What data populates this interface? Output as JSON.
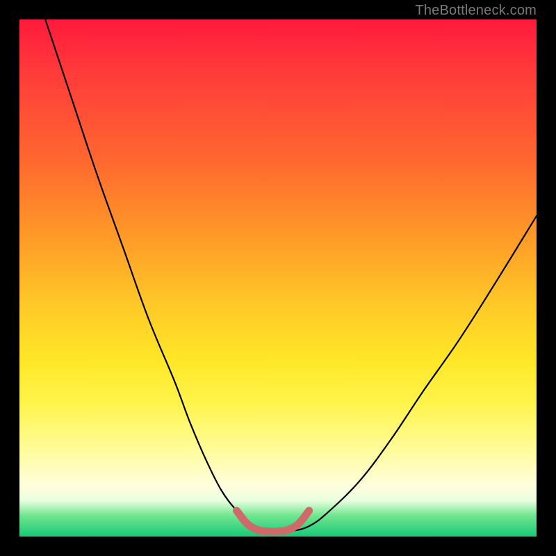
{
  "watermark": "TheBottleneck.com",
  "colors": {
    "frame": "#000000",
    "curve_stroke": "#000000",
    "marker_stroke": "#cf6a6a",
    "gradient_top": "#ff1a3e",
    "gradient_bottom": "#18c979"
  },
  "chart_data": {
    "type": "line",
    "title": "",
    "xlabel": "",
    "ylabel": "",
    "xlim": [
      0,
      100
    ],
    "ylim": [
      0,
      100
    ],
    "grid": false,
    "legend": false,
    "series": [
      {
        "name": "bottleneck-curve",
        "x": [
          5,
          10,
          15,
          20,
          25,
          30,
          33,
          36,
          39,
          42,
          45,
          48,
          52,
          56,
          60,
          66,
          72,
          78,
          85,
          92,
          100
        ],
        "y": [
          100,
          85,
          70,
          56,
          42,
          30,
          22,
          15,
          9,
          5,
          2,
          1,
          1,
          2,
          5,
          11,
          19,
          28,
          38,
          49,
          62
        ]
      },
      {
        "name": "optimal-range-marker",
        "x": [
          42,
          44,
          46,
          48,
          50,
          52,
          54,
          56
        ],
        "y": [
          5,
          2.5,
          1.3,
          1,
          1,
          1.3,
          2.5,
          5
        ]
      }
    ],
    "annotations": []
  }
}
